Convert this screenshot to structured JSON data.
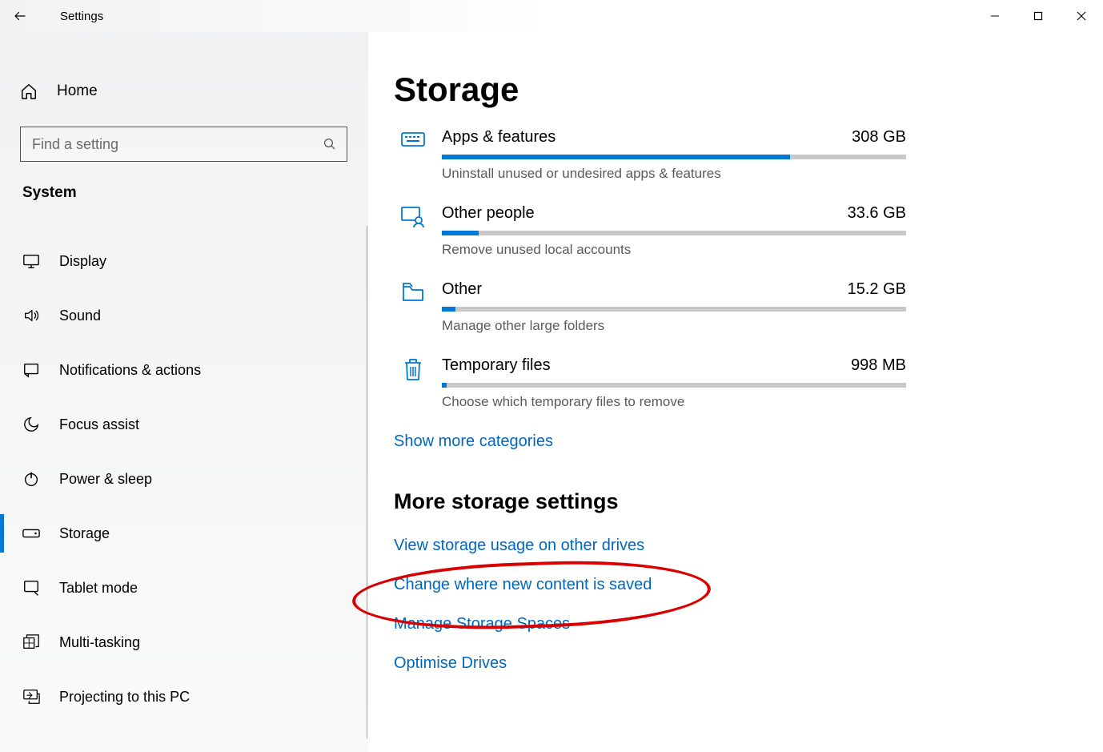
{
  "window": {
    "title": "Settings"
  },
  "sidebar": {
    "home_label": "Home",
    "search_placeholder": "Find a setting",
    "group_label": "System",
    "items": [
      {
        "id": "display",
        "label": "Display"
      },
      {
        "id": "sound",
        "label": "Sound"
      },
      {
        "id": "notifications",
        "label": "Notifications & actions"
      },
      {
        "id": "focus",
        "label": "Focus assist"
      },
      {
        "id": "power",
        "label": "Power & sleep"
      },
      {
        "id": "storage",
        "label": "Storage",
        "active": true
      },
      {
        "id": "tablet",
        "label": "Tablet mode"
      },
      {
        "id": "multitask",
        "label": "Multi-tasking"
      },
      {
        "id": "projecting",
        "label": "Projecting to this PC"
      }
    ]
  },
  "main": {
    "title": "Storage",
    "categories": [
      {
        "name": "Apps & features",
        "size": "308 GB",
        "pct": 75,
        "desc": "Uninstall unused or undesired apps & features"
      },
      {
        "name": "Other people",
        "size": "33.6 GB",
        "pct": 8,
        "desc": "Remove unused local accounts"
      },
      {
        "name": "Other",
        "size": "15.2 GB",
        "pct": 3,
        "desc": "Manage other large folders"
      },
      {
        "name": "Temporary files",
        "size": "998 MB",
        "pct": 1,
        "desc": "Choose which temporary files to remove"
      }
    ],
    "show_more": "Show more categories",
    "more_heading": "More storage settings",
    "links": [
      "View storage usage on other drives",
      "Change where new content is saved",
      "Manage Storage Spaces",
      "Optimise Drives"
    ]
  }
}
